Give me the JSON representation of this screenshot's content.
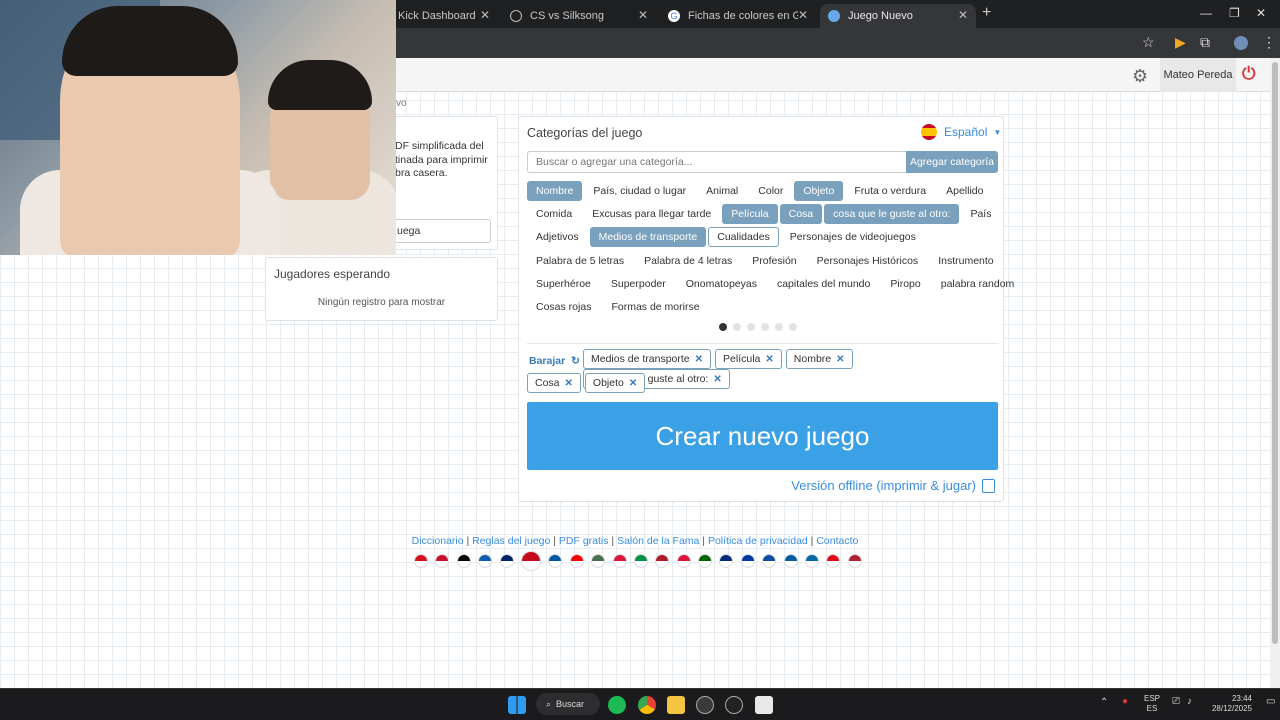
{
  "browser": {
    "tabs": [
      {
        "title": "Kick Dashboard",
        "active": false
      },
      {
        "title": "CS vs Silksong",
        "active": false
      },
      {
        "title": "Fichas de colores en Google - E",
        "active": false
      },
      {
        "title": "Juego Nuevo",
        "active": true
      }
    ],
    "new_tab": "+",
    "minimize": "—",
    "restore": "❐",
    "close": "✕"
  },
  "header": {
    "user_name": "Mateo Pereda"
  },
  "left": {
    "crumb": "vo",
    "description": "DF simplificada del tinada para imprimir bra casera.",
    "input_value": "uega",
    "waiting_title": "Jugadores esperando",
    "waiting_empty": "Ningún registro para mostrar"
  },
  "main": {
    "title": "Categorías del juego",
    "language": "Español",
    "search_placeholder": "Buscar o agregar una categoría...",
    "add_button": "Agregar categoría",
    "category_rows": [
      [
        {
          "label": "Nombre",
          "selected": true
        },
        {
          "label": "País, ciudad o lugar"
        },
        {
          "label": "Animal"
        },
        {
          "label": "Color"
        },
        {
          "label": "Objeto",
          "selected": true
        },
        {
          "label": "Fruta o verdura"
        },
        {
          "label": "Apellido"
        }
      ],
      [
        {
          "label": "Comida"
        },
        {
          "label": "Excusas para llegar tarde"
        },
        {
          "label": "Película",
          "selected": true
        },
        {
          "label": "Cosa",
          "selected": true
        },
        {
          "label": "cosa que le guste al otro:",
          "selected": true
        },
        {
          "label": "País"
        }
      ],
      [
        {
          "label": "Adjetivos"
        },
        {
          "label": "Medios de transporte",
          "selected": true
        },
        {
          "label": "Cualidades",
          "hover": true
        },
        {
          "label": "Personajes de videojuegos"
        }
      ],
      [
        {
          "label": "Palabra de 5 letras"
        },
        {
          "label": "Palabra de 4 letras"
        },
        {
          "label": "Profesión"
        },
        {
          "label": "Personajes Históricos"
        },
        {
          "label": "Instrumento"
        }
      ],
      [
        {
          "label": "Superhéroe"
        },
        {
          "label": "Superpoder"
        },
        {
          "label": "Onomatopeyas"
        },
        {
          "label": "capitales del mundo"
        },
        {
          "label": "Piropo"
        },
        {
          "label": "palabra random"
        }
      ],
      [
        {
          "label": "Cosas rojas"
        },
        {
          "label": "Formas de morirse"
        }
      ]
    ],
    "pager_total": 6,
    "pager_current": 1,
    "shuffle_label": "Barajar",
    "selected_chips_row1": [
      "Medios de transporte",
      "Película",
      "Nombre",
      "cosa que le guste al otro:"
    ],
    "selected_chips_row2": [
      "Cosa",
      "Objeto"
    ],
    "create_button": "Crear nuevo juego",
    "offline_link": "Versión offline (imprimir & jugar)"
  },
  "footer": {
    "links": [
      "Diccionario",
      "Reglas del juego",
      "PDF gratis",
      "Salón de la Fama",
      "Política de privacidad",
      "Contacto"
    ],
    "separator": " | ",
    "flag_colors": [
      "#d7141a",
      "#c8102e",
      "#000000",
      "#0d5eaf",
      "#012169",
      "#c60b1e",
      "#0055a4",
      "#ff0000",
      "#477050",
      "#dc143c",
      "#009246",
      "#ae1c28",
      "#dc143c",
      "#006600",
      "#002b7f",
      "#0039a6",
      "#0b4ea2",
      "#005da4",
      "#006aa7",
      "#e30a17",
      "#b22234"
    ]
  },
  "taskbar": {
    "search_label": "Buscar",
    "lang_top": "ESP",
    "lang_bottom": "ES",
    "time": "23:44",
    "date": "28/12/2025"
  }
}
